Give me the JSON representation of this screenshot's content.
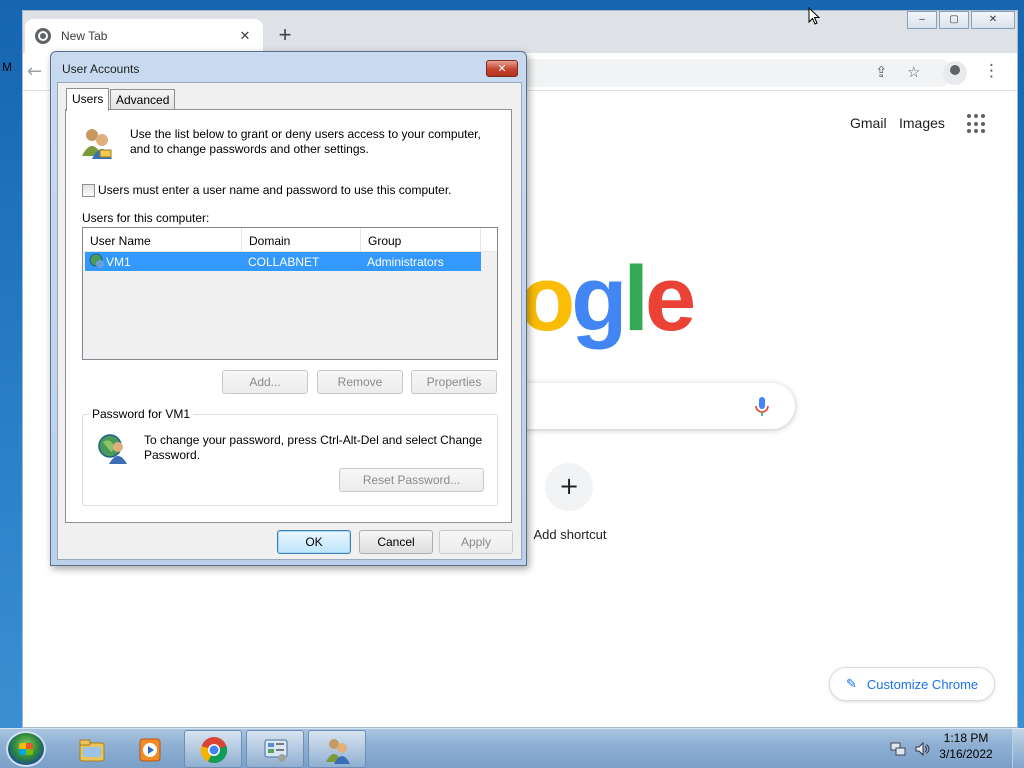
{
  "chrome": {
    "tab_title": "New Tab",
    "tab_close": "✕",
    "new_tab": "+",
    "win_buttons": [
      "‒",
      "▢",
      "✕"
    ],
    "back": "←",
    "share": "⇪",
    "star": "☆",
    "menu": "⋮",
    "gmail": "Gmail",
    "images": "Images",
    "logo_letters": [
      "o",
      "g",
      "l",
      "e"
    ],
    "shortcut_plus": "+",
    "add_shortcut": "Add shortcut",
    "customize_pencil": "✎",
    "customize_label": "Customize Chrome",
    "colors": {
      "logo_blue": "#4285f4",
      "logo_yellow": "#fbbc05",
      "logo_green": "#34a853",
      "logo_red": "#ea4335",
      "accent": "#1a73e8"
    }
  },
  "dialog": {
    "title": "User Accounts",
    "close": "✕",
    "tabs": [
      {
        "label": "Users",
        "active": true
      },
      {
        "label": "Advanced",
        "active": false
      }
    ],
    "intro_line1": "Use the list below to grant or deny users access to your computer,",
    "intro_line2": "and to change passwords and other settings.",
    "checkbox_label": "Users must enter a user name and password to use this computer.",
    "checkbox_checked": false,
    "users_label": "Users for this computer:",
    "columns": [
      "User Name",
      "Domain",
      "Group"
    ],
    "rows": [
      {
        "user": "VM1",
        "domain": "COLLABNET",
        "group": "Administrators",
        "selected": true
      }
    ],
    "buttons": {
      "add": "Add...",
      "remove": "Remove",
      "properties": "Properties"
    },
    "password_group_title": "Password for VM1",
    "password_text_line1": "To change your password, press Ctrl-Alt-Del and select Change",
    "password_text_line2": "Password.",
    "reset_password": "Reset Password...",
    "ok": "OK",
    "cancel": "Cancel",
    "apply": "Apply",
    "selection_color": "#3399ff"
  },
  "desktop": {
    "left_letter": "M"
  },
  "taskbar": {
    "items": [
      {
        "name": "windows-explorer",
        "state": "pinned"
      },
      {
        "name": "windows-media-player",
        "state": "pinned"
      },
      {
        "name": "google-chrome",
        "state": "open"
      },
      {
        "name": "control-panel",
        "state": "open"
      },
      {
        "name": "user-accounts",
        "state": "open"
      }
    ],
    "time": "1:18 PM",
    "date": "3/16/2022"
  }
}
